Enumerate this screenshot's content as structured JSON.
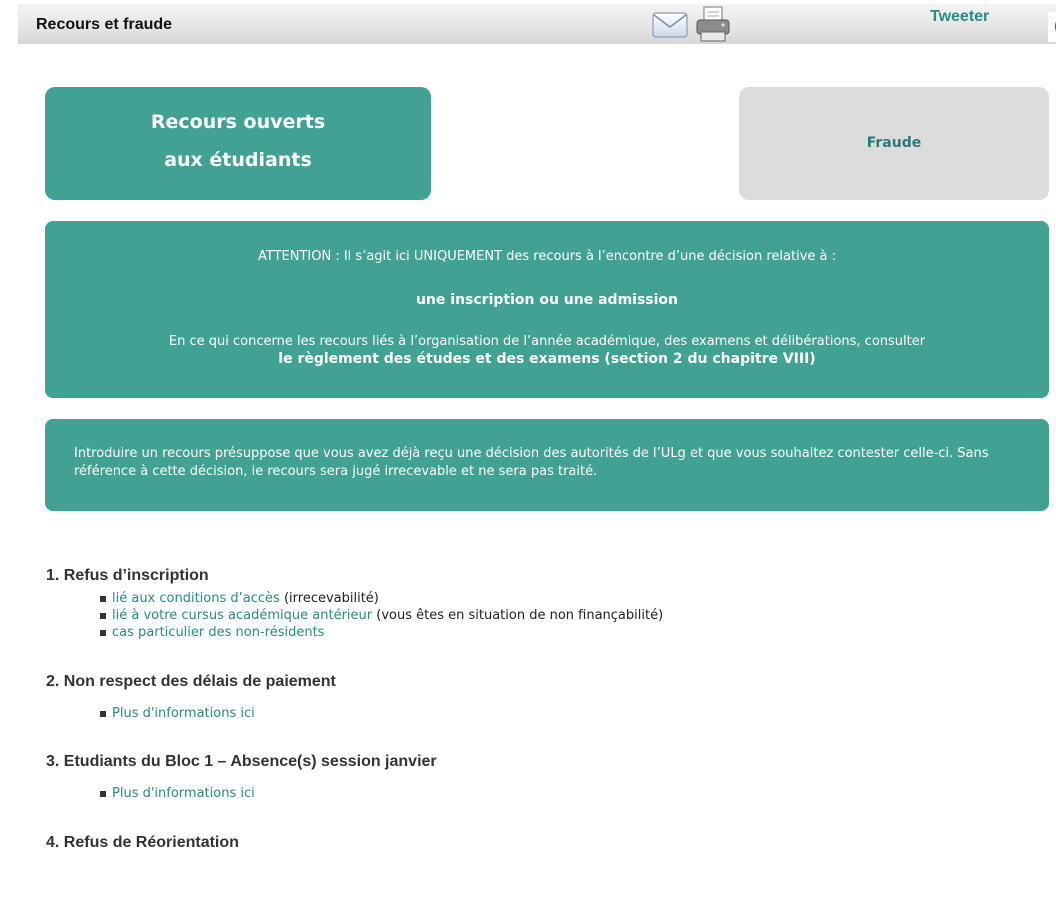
{
  "header": {
    "title": "Recours et fraude",
    "tweet_label": "Tweeter",
    "icons": [
      "mail-icon",
      "print-icon",
      "google-plus-icon"
    ]
  },
  "tiles": {
    "recours": {
      "line1": "Recours ouverts",
      "line2": "aux étudiants"
    },
    "fraude": {
      "label": "Fraude"
    }
  },
  "attention": {
    "line1": "ATTENTION : Il s’agit ici UNIQUEMENT des recours à l’encontre d’une décision relative à :",
    "line2": "une inscription ou une admission",
    "line3": "En ce qui concerne les recours liés à l’organisation de  l’année académique, des examens et délibérations, consulter",
    "line4": "le règlement des études et des examens (section 2 du chapitre VIII)"
  },
  "intro": {
    "text": "Introduire un recours présuppose que vous avez déjà reçu une décision des autorités de l’ULg et que vous souhaitez contester celle-ci. Sans référence à cette décision, le recours sera jugé irrecevable et ne sera pas traité."
  },
  "sections": [
    {
      "title": "1. Refus d’inscription",
      "items": [
        {
          "link": "lié aux conditions d’accès",
          "note": " (irrecevabilité)"
        },
        {
          "link": "lié à votre cursus académique antérieur",
          "note": " (vous êtes en situation de non finançabilité)"
        },
        {
          "link": "cas particulier des non-résidents",
          "note": ""
        }
      ]
    },
    {
      "title": "2. Non respect des délais de paiement",
      "items": [
        {
          "link": "Plus d'informations ici",
          "note": ""
        }
      ]
    },
    {
      "title": "3. Etudiants du Bloc 1 – Absence(s) session janvier",
      "items": [
        {
          "link": "Plus d'informations ici",
          "note": ""
        }
      ]
    },
    {
      "title": "4. Refus de Réorientation",
      "items": []
    }
  ],
  "colors": {
    "teal_panel": "#41a293",
    "link_teal": "#2a8a84",
    "fraude_tile": "#dcdcdc",
    "fraude_text": "#2a7b76",
    "gplus_red": "#d23f31"
  }
}
